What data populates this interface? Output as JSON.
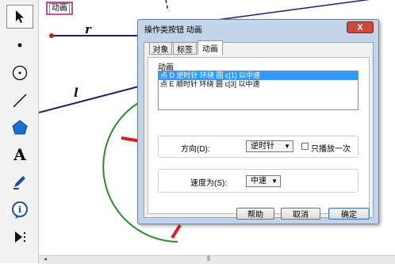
{
  "toolbar": {
    "tools": [
      {
        "name": "arrow-select-tool",
        "icon": "arrow-icon",
        "active": true
      },
      {
        "name": "point-tool",
        "icon": "point-icon"
      },
      {
        "name": "compass-tool",
        "icon": "circle-icon"
      },
      {
        "name": "straightedge-tool",
        "icon": "line-icon"
      },
      {
        "name": "polygon-tool",
        "icon": "pentagon-icon"
      },
      {
        "name": "text-tool",
        "label": "A",
        "icon": "text-icon"
      },
      {
        "name": "marker-tool",
        "icon": "pencil-icon"
      },
      {
        "name": "information-tool",
        "label": "i",
        "icon": "info-icon"
      },
      {
        "name": "custom-tool",
        "icon": "play-more-icon"
      }
    ]
  },
  "canvas": {
    "animate_button_label": "动画",
    "segment_label_r": "r",
    "line_label_l": "l",
    "circle_color": "#2e8b2e",
    "line_color": "#1f1f6e",
    "segment_color": "#1f1f6e",
    "point_color": "#b22222"
  },
  "dialog": {
    "title": "操作类按钮 动画",
    "close_label": "X",
    "tabs": [
      {
        "label": "对象",
        "selected": false
      },
      {
        "label": "标签",
        "selected": false
      },
      {
        "label": "动画",
        "selected": true
      }
    ],
    "section_label": "动画",
    "animations": [
      {
        "text": "点 D 逆时针 环绕 圆 c[1] 以中速",
        "selected": true
      },
      {
        "text": "点 E 顺时针 环绕 圆 c[3] 以中速",
        "selected": false
      }
    ],
    "direction": {
      "label": "方向(D):",
      "value": "逆时针"
    },
    "play_once": {
      "label": "只播放一次",
      "checked": false
    },
    "speed": {
      "label": "速度为(S):",
      "value": "中速"
    },
    "buttons": {
      "help": "帮助",
      "cancel": "取消",
      "ok": "确定"
    }
  },
  "scrollbar": {
    "grip": "⦀"
  }
}
